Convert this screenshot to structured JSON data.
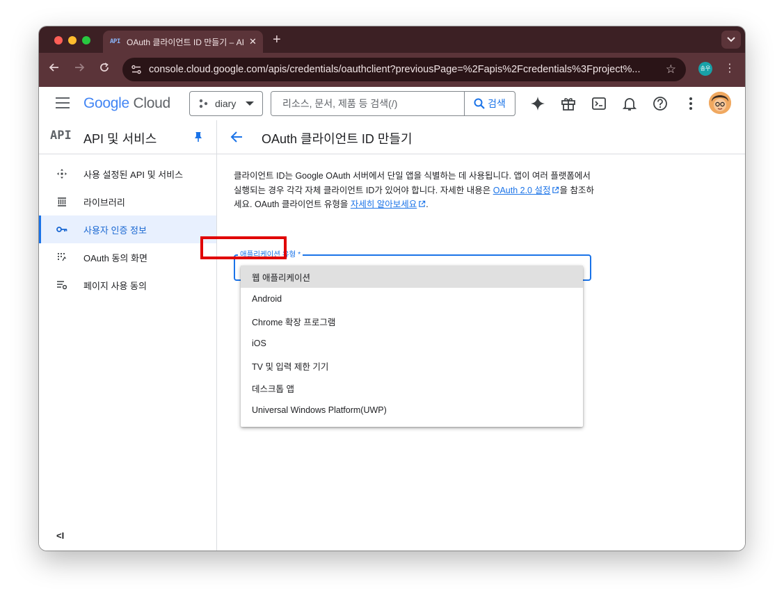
{
  "browser": {
    "tab_favicon": "API",
    "tab_title": "OAuth 클라이언트 ID 만들기 – AP",
    "new_tab": "+",
    "url": "console.cloud.google.com/apis/credentials/oauthclient?previousPage=%2Fapis%2Fcredentials%3Fproject%...",
    "profile_badge": "송우"
  },
  "header": {
    "logo_google": "Google",
    "logo_cloud": "Cloud",
    "project_name": "diary",
    "search_placeholder": "리소스, 문서, 제품 등 검색(/)",
    "search_button": "검색"
  },
  "sidebar": {
    "icon_text": "API",
    "title": "API 및 서비스",
    "items": [
      {
        "label": "사용 설정된 API 및 서비스",
        "icon": "enabled-apis-icon"
      },
      {
        "label": "라이브러리",
        "icon": "library-icon"
      },
      {
        "label": "사용자 인증 정보",
        "icon": "key-icon",
        "active": true
      },
      {
        "label": "OAuth 동의 화면",
        "icon": "consent-screen-icon"
      },
      {
        "label": "페이지 사용 동의",
        "icon": "page-usage-icon"
      }
    ],
    "collapse": "<I"
  },
  "main": {
    "title": "OAuth 클라이언트 ID 만들기",
    "desc_part1": "클라이언트 ID는 Google OAuth 서버에서 단일 앱을 식별하는 데 사용됩니다. 앱이 여러 플랫폼에서 실행되는 경우 각각 자체 클라이언트 ID가 있어야 합니다. 자세한 내용은 ",
    "desc_link1": "OAuth 2.0 설정",
    "desc_part2": "을 참조하세요. OAuth 클라이언트 유형을 ",
    "desc_link2": "자세히 알아보세요",
    "desc_part3": ".",
    "select_label": "애플리케이션 유형 *",
    "options": [
      "웹 애플리케이션",
      "Android",
      "Chrome 확장 프로그램",
      "iOS",
      "TV 및 입력 제한 기기",
      "데스크톱 앱",
      "Universal Windows Platform(UWP)"
    ]
  },
  "colors": {
    "accent": "#1a73e8",
    "highlight": "#e00000",
    "chrome_frame": "#5b3439"
  }
}
